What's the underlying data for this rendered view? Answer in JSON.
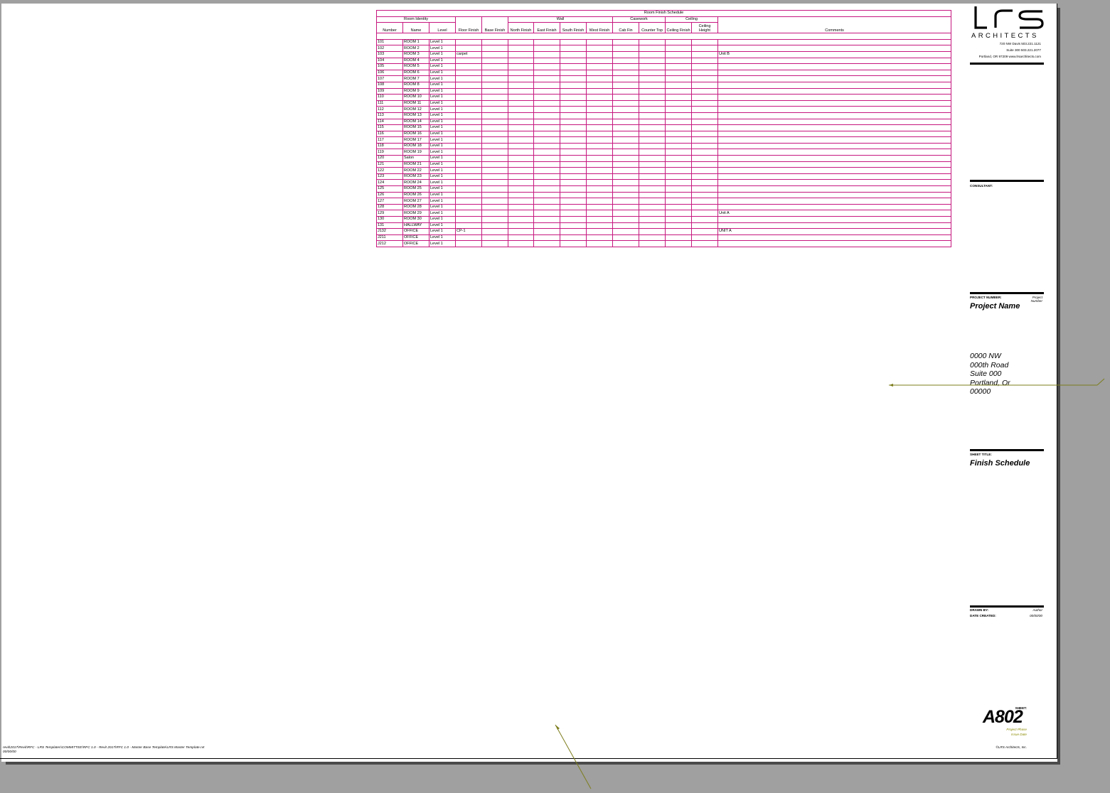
{
  "schedule": {
    "title": "Room Finish Schedule",
    "groups": {
      "room_identity": "Room Identity",
      "wall": "Wall",
      "casework": "Casework",
      "ceiling": "Ceiling"
    },
    "columns": {
      "number": "Number",
      "name": "Name",
      "level": "Level",
      "floor": "Floor Finish",
      "base": "Base Finish",
      "north": "North Finish",
      "east": "East Finish",
      "south": "South Finish",
      "west": "West Finish",
      "cab": "Cab Fin",
      "counter": "Counter Top",
      "ceiling_finish": "Ceiling Finish",
      "ceiling_height": "Ceiling Height",
      "comments": "Comments"
    },
    "rows": [
      {
        "number": "101",
        "name": "ROOM 1",
        "level": "Level 1",
        "floor": "",
        "comments": ""
      },
      {
        "number": "102",
        "name": "ROOM 2",
        "level": "Level 1",
        "floor": "",
        "comments": ""
      },
      {
        "number": "103",
        "name": "ROOM 3",
        "level": "Level 1",
        "floor": "carpet",
        "comments": "Unit B"
      },
      {
        "number": "104",
        "name": "ROOM 4",
        "level": "Level 1",
        "floor": "",
        "comments": ""
      },
      {
        "number": "105",
        "name": "ROOM 5",
        "level": "Level 1",
        "floor": "",
        "comments": ""
      },
      {
        "number": "106",
        "name": "ROOM 6",
        "level": "Level 1",
        "floor": "",
        "comments": ""
      },
      {
        "number": "107",
        "name": "ROOM 7",
        "level": "Level 1",
        "floor": "",
        "comments": ""
      },
      {
        "number": "108",
        "name": "ROOM 8",
        "level": "Level 1",
        "floor": "",
        "comments": ""
      },
      {
        "number": "109",
        "name": "ROOM 9",
        "level": "Level 1",
        "floor": "",
        "comments": ""
      },
      {
        "number": "110",
        "name": "ROOM 10",
        "level": "Level 1",
        "floor": "",
        "comments": ""
      },
      {
        "number": "111",
        "name": "ROOM 11",
        "level": "Level 1",
        "floor": "",
        "comments": ""
      },
      {
        "number": "112",
        "name": "ROOM 12",
        "level": "Level 1",
        "floor": "",
        "comments": ""
      },
      {
        "number": "113",
        "name": "ROOM 13",
        "level": "Level 1",
        "floor": "",
        "comments": ""
      },
      {
        "number": "114",
        "name": "ROOM 14",
        "level": "Level 1",
        "floor": "",
        "comments": ""
      },
      {
        "number": "115",
        "name": "ROOM 15",
        "level": "Level 1",
        "floor": "",
        "comments": ""
      },
      {
        "number": "116",
        "name": "ROOM 16",
        "level": "Level 1",
        "floor": "",
        "comments": ""
      },
      {
        "number": "117",
        "name": "ROOM 17",
        "level": "Level 1",
        "floor": "",
        "comments": ""
      },
      {
        "number": "118",
        "name": "ROOM 18",
        "level": "Level 1",
        "floor": "",
        "comments": ""
      },
      {
        "number": "119",
        "name": "ROOM 19",
        "level": "Level 1",
        "floor": "",
        "comments": ""
      },
      {
        "number": "120",
        "name": "Salon",
        "level": "Level 1",
        "floor": "",
        "comments": ""
      },
      {
        "number": "121",
        "name": "ROOM 21",
        "level": "Level 1",
        "floor": "",
        "comments": ""
      },
      {
        "number": "122",
        "name": "ROOM 22",
        "level": "Level 1",
        "floor": "",
        "comments": ""
      },
      {
        "number": "123",
        "name": "ROOM 23",
        "level": "Level 1",
        "floor": "",
        "comments": ""
      },
      {
        "number": "124",
        "name": "ROOM 24",
        "level": "Level 1",
        "floor": "",
        "comments": ""
      },
      {
        "number": "125",
        "name": "ROOM 25",
        "level": "Level 1",
        "floor": "",
        "comments": ""
      },
      {
        "number": "126",
        "name": "ROOM 26",
        "level": "Level 1",
        "floor": "",
        "comments": ""
      },
      {
        "number": "127",
        "name": "ROOM 27",
        "level": "Level 1",
        "floor": "",
        "comments": ""
      },
      {
        "number": "128",
        "name": "ROOM 28",
        "level": "Level 1",
        "floor": "",
        "comments": ""
      },
      {
        "number": "129",
        "name": "ROOM 29",
        "level": "Level 1",
        "floor": "",
        "comments": "Unit A"
      },
      {
        "number": "130",
        "name": "ROOM 30",
        "level": "Level 1",
        "floor": "",
        "comments": ""
      },
      {
        "number": "131",
        "name": "HALLWAY",
        "level": "Level 1",
        "floor": "",
        "comments": ""
      },
      {
        "number": "J132",
        "name": "OFFICE",
        "level": "Level 1",
        "floor": "CP-1",
        "comments": "UNIT A"
      },
      {
        "number": "J211",
        "name": "OFFICE",
        "level": "Level 1",
        "floor": "",
        "comments": ""
      },
      {
        "number": "J212",
        "name": "OFFICE",
        "level": "Level 1",
        "floor": "",
        "comments": ""
      }
    ]
  },
  "titleblock": {
    "logo": "LRS",
    "firm": "ARCHITECTS",
    "address_lines": [
      "720 NW Davis   503.221.1121",
      "Suite 300   503.221.2077",
      "Portland, OR  97209   www.lrsarchitects.com"
    ],
    "consultant_label": "CONSULTANT:",
    "project_number_label": "PROJECT NUMBER:",
    "project_number_value": "Project Number",
    "project_name": "Project Name",
    "project_address": [
      "0000 NW",
      "000th Road",
      "Suite 000",
      "Portland, Or",
      "00000"
    ],
    "sheet_title_label": "SHEET TITLE:",
    "sheet_title": "Finish Schedule",
    "drawn_by_label": "DRAWN BY:",
    "drawn_by_value": "Author",
    "date_created_label": "DATE CREATED:",
    "date_created_value": "00/00/00",
    "sheet_label": "SHEET:",
    "sheet_number": "A802",
    "sheet_sub1": "Project Phase",
    "sheet_sub2": "Issue Date",
    "copyright": "©LRS Architects, Inc."
  },
  "footer": {
    "file_path": "revit\\2017\\Revit\\RFC - LRS Templates\\COMMITTEE\\RFC 1.0 - Revit 2017\\RFC 1.0 - Master Base Template\\LRS Master Template.rvt",
    "file_date": "00/00/00"
  },
  "colors": {
    "grid": "#c6177f",
    "leader": "#7d7d1e"
  }
}
